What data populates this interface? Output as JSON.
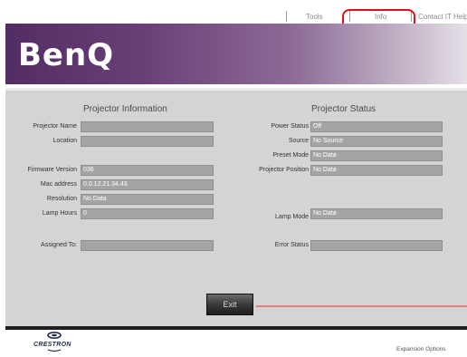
{
  "nav": {
    "links": [
      "Tools",
      "Info",
      "Contact IT Help"
    ],
    "highlight_color": "#e0101a"
  },
  "banner": {
    "logo": "BenQ",
    "gradient_start": "#522d62",
    "gradient_end": "#e6e0e7"
  },
  "info": {
    "title": "Projector Information",
    "projector_name": {
      "label": "Projector Name",
      "value": ""
    },
    "location": {
      "label": "Location",
      "value": ""
    },
    "firmware": {
      "label": "Firmware Version",
      "value": "036"
    },
    "mac": {
      "label": "Mac address",
      "value": "0.0.12.21.34.43"
    },
    "resolution": {
      "label": "Resolution",
      "value": "No Data"
    },
    "lamp_hours": {
      "label": "Lamp Hours",
      "value": "0"
    },
    "assigned_to": {
      "label": "Assigned To:",
      "value": ""
    }
  },
  "status": {
    "title": "Projector Status",
    "power": {
      "label": "Power Status",
      "value": "Off"
    },
    "source": {
      "label": "Source",
      "value": "No Source"
    },
    "preset": {
      "label": "Preset Mode",
      "value": "No Data"
    },
    "position": {
      "label": "Projector Position",
      "value": "No Data"
    },
    "lamp_mode": {
      "label": "Lamp Mode",
      "value": "No Data"
    },
    "error": {
      "label": "Error Status",
      "value": ""
    }
  },
  "exit_label": "Exit",
  "footer": {
    "brand": "CRESTRON",
    "expansion": "Expansion Options"
  }
}
